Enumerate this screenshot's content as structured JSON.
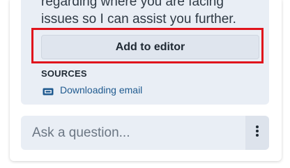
{
  "answer": {
    "lines": [
      "regarding where you are facing",
      "issues so I can assist you further."
    ]
  },
  "actions": {
    "add_to_editor_label": "Add to editor"
  },
  "sources": {
    "heading": "SOURCES",
    "items": [
      {
        "label": "Downloading email",
        "icon": "ticket-icon"
      }
    ]
  },
  "ask": {
    "placeholder": "Ask a question...",
    "menu_icon": "vertical-ellipsis-icon"
  },
  "colors": {
    "highlight": "#e0141c",
    "link": "#1f5a8f",
    "card_bg": "#e9eef5"
  }
}
